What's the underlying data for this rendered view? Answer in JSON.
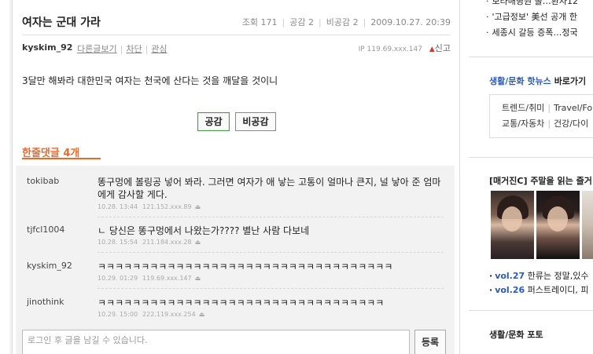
{
  "post": {
    "title": "여자는 군대 가라",
    "stats": {
      "views_label": "조회 171",
      "agree_label": "공감 2",
      "disagree_label": "비공감 2",
      "datetime": "2009.10.27. 20:39"
    },
    "author": "kyskim_92",
    "author_links": [
      "다른글보기",
      "차단",
      "관심"
    ],
    "ip": "IP 119.69.xxx.147",
    "report_label": "신고",
    "body": "3달만 해봐라 대한민국 여자는 천국에 산다는 것을 깨달을 것이니",
    "agree_button": "공감",
    "disagree_button": "비공감"
  },
  "comments_header": {
    "label": "한줄댓글",
    "count": "4개"
  },
  "comments": [
    {
      "user": "tokibab",
      "text": "똥구멍에 볼링공 넣어 봐라. 그러면 여자가 애 낳는 고통이 얼마나 큰지, 널 낳아 준 엄마에게 감사할 게다.",
      "date": "10.28. 13:44",
      "ip": "121.152.xxx.89"
    },
    {
      "user": "tjfcl1004",
      "text": "ㄴ 당신은 똥구멍에서 나왔는가???? 별난 사람 다보네",
      "date": "10.28. 15:54",
      "ip": "211.184.xxx.28"
    },
    {
      "user": "kyskim_92",
      "text": "ㅋㅋㅋㅋㅋㅋㅋㅋㅋㅋㅋㅋㅋㅋㅋㅋㅋㅋㅋㅋㅋㅋㅋㅋㅋㅋㅋㅋㅋㅋㅋㅋㅋㅋ",
      "date": "10.29. 01:29",
      "ip": "119.69.xxx.147"
    },
    {
      "user": "jinothink",
      "text": "ㅋㅋㅋㅋㅋㅋㅋㅋㅋㅋㅋㅋㅋㅋㅋㅋㅋㅋㅋㅋㅋㅋㅋㅋㅋㅋㅋㅋㅋㅋㅋㅋㅋ",
      "date": "10.29. 15:00",
      "ip": "222.119.xxx.254"
    }
  ],
  "comment_input": {
    "placeholder": "로그인 후 글을 남길 수 있습니다.",
    "submit_label": "등록"
  },
  "sidebar": {
    "news": [
      "보라매병원 볼…환자12",
      "'고급정보' 美선 공개 한",
      "세종시 갈등 증폭…정국"
    ],
    "section_title": "생활/문화 핫뉴스",
    "section_link": "바로가기",
    "tags_row1": [
      "트렌드/취미",
      "Travel/Fo"
    ],
    "tags_row2": [
      "교통/자동차",
      "건강/다이"
    ],
    "magazine_title": "[매거진C] 주말을 읽는 즐거",
    "magazine_items": [
      {
        "vol": "vol.27",
        "text": "한류는 정말,있수"
      },
      {
        "vol": "vol.26",
        "text": "퍼스트레이디, 피"
      }
    ],
    "photo_title": "생활/문화 포토"
  },
  "colors": {
    "accent_orange": "#e86a2a",
    "link_blue": "#2a5ab5"
  }
}
